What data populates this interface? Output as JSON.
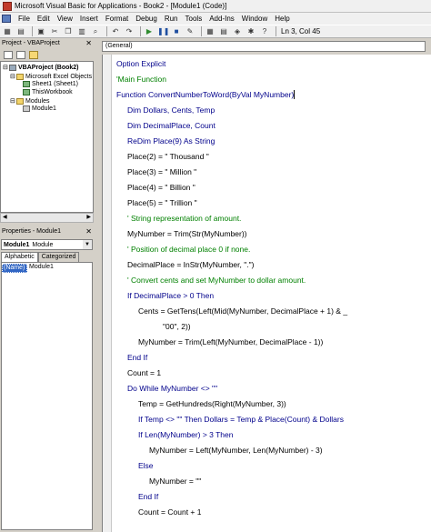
{
  "window": {
    "title": "Microsoft Visual Basic for Applications - Book2 - [Module1 (Code)]"
  },
  "menu": [
    "File",
    "Edit",
    "View",
    "Insert",
    "Format",
    "Debug",
    "Run",
    "Tools",
    "Add-Ins",
    "Window",
    "Help"
  ],
  "toolbar": {
    "position": "Ln 3, Col 45"
  },
  "project": {
    "title": "Project - VBAProject",
    "tree": [
      {
        "label": "VBAProject (Book2)",
        "icon": "project-icon"
      },
      {
        "label": "Microsoft Excel Objects",
        "icon": "folder-icon"
      },
      {
        "label": "Sheet1 (Sheet1)",
        "icon": "sheet-icon"
      },
      {
        "label": "ThisWorkbook",
        "icon": "workbook-icon"
      },
      {
        "label": "Modules",
        "icon": "folder-icon"
      },
      {
        "label": "Module1",
        "icon": "module-icon"
      }
    ]
  },
  "properties": {
    "title": "Properties - Module1",
    "object_name": "Module1",
    "object_type": "Module",
    "tabs": [
      "Alphabetic",
      "Categorized"
    ],
    "rows": [
      {
        "key": "(Name)",
        "value": "Module1"
      }
    ]
  },
  "code": {
    "object_combo": "(General)",
    "lines": [
      "Option Explicit",
      "'Main Function",
      "Function ConvertNumberToWord(ByVal MyNumber)",
      "Dim Dollars, Cents, Temp",
      "Dim DecimalPlace, Count",
      "ReDim Place(9) As String",
      "Place(2) = \" Thousand \"",
      "Place(3) = \" Million \"",
      "Place(4) = \" Billion \"",
      "Place(5) = \" Trillion \"",
      "' String representation of amount.",
      "MyNumber = Trim(Str(MyNumber))",
      "' Position of decimal place 0 if none.",
      "DecimalPlace = InStr(MyNumber, \".\")",
      "' Convert cents and set MyNumber to dollar amount.",
      "If DecimalPlace > 0 Then",
      "Cents = GetTens(Left(Mid(MyNumber, DecimalPlace + 1) & _",
      "\"00\", 2))",
      "MyNumber = Trim(Left(MyNumber, DecimalPlace - 1))",
      "End If",
      "Count = 1",
      "Do While MyNumber <> \"\"",
      "Temp = GetHundreds(Right(MyNumber, 3))",
      "If Temp <> \"\" Then Dollars = Temp & Place(Count) & Dollars",
      "If Len(MyNumber) > 3 Then",
      "MyNumber = Left(MyNumber, Len(MyNumber) - 3)",
      "Else",
      "MyNumber = \"\"",
      "End If",
      "Count = Count + 1"
    ]
  }
}
